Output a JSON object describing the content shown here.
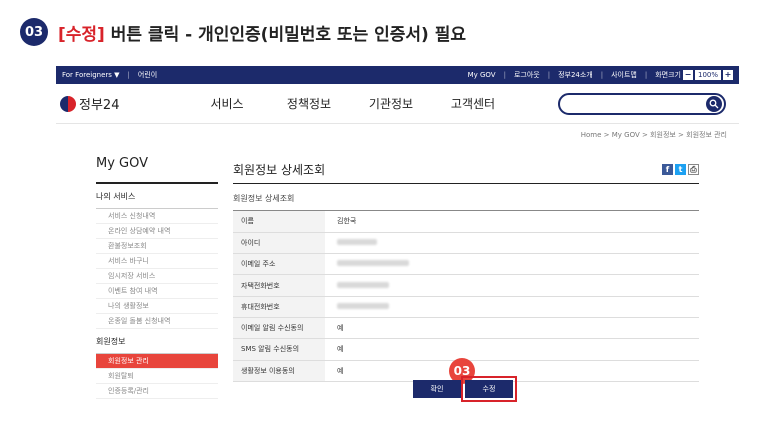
{
  "step": {
    "number": "03",
    "bracket_label": "[수정]",
    "title_rest": " 버튼 클릭 - 개인인증(비밀번호 또는 인증서) 필요"
  },
  "utilbar": {
    "for_foreigners": "For Foreigners ▼",
    "kids": "어린이",
    "mygov": "My GOV",
    "login": "로그아웃",
    "intro": "정부24소개",
    "sitemap": "사이트맵",
    "zoom_label": "화면크기",
    "zoom_value": "100%"
  },
  "header": {
    "logo_text": "정부24",
    "nav": [
      "서비스",
      "정책정보",
      "기관정보",
      "고객센터"
    ],
    "search_placeholder": ""
  },
  "breadcrumb": "Home > My GOV > 회원정보 > 회원정보 관리",
  "lnb": {
    "title": "My GOV",
    "section1": "나의 서비스",
    "items1": [
      "서비스 신청내역",
      "온라인 상담예약 내역",
      "환불정보조회",
      "서비스 바구니",
      "임시저장 서비스",
      "이벤트 참여 내역",
      "나의 생활정보",
      "온종일 돌봄 신청내역"
    ],
    "section2": "회원정보",
    "items2": [
      "회원정보 관리",
      "회원탈퇴",
      "인증등록/관리"
    ]
  },
  "content": {
    "title": "회원정보 상세조회",
    "subtitle": "회원정보 상세조회",
    "rows": [
      {
        "label": "이름",
        "value": "김한국"
      },
      {
        "label": "아이디",
        "value": ""
      },
      {
        "label": "이메일 주소",
        "value": ""
      },
      {
        "label": "자택전화번호",
        "value": ""
      },
      {
        "label": "휴대전화번호",
        "value": ""
      },
      {
        "label": "이메일 알림 수신동의",
        "value": "예"
      },
      {
        "label": "SMS 알림 수신동의",
        "value": "예"
      },
      {
        "label": "생활정보 이용동의",
        "value": "예"
      }
    ],
    "confirm_label": "확인",
    "edit_label": "수정",
    "badge": "03"
  },
  "colors": {
    "navy": "#1c2a6b",
    "accent_red": "#d8232a",
    "active_red": "#e8453c"
  }
}
